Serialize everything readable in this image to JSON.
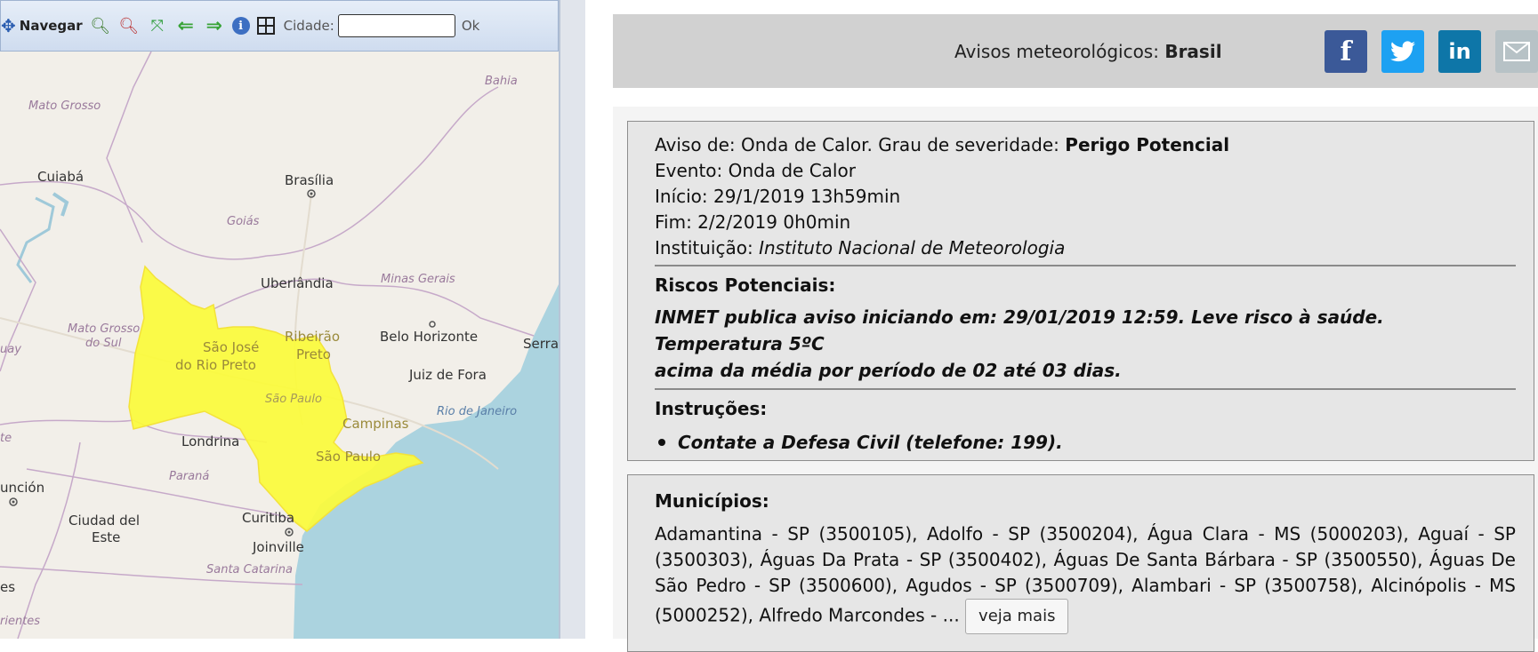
{
  "toolbar": {
    "navigate_label": "Navegar",
    "city_label": "Cidade:",
    "city_value": "",
    "ok_label": "Ok"
  },
  "map": {
    "water_color": "#abd3df",
    "land_color": "#f2efe9",
    "alert_color": "#fbfb3a",
    "labels": {
      "bahia": "Bahia",
      "mato_grosso": "Mato Grosso",
      "cuiaba": "Cuiabá",
      "brasilia": "Brasília",
      "goias": "Goiás",
      "uberlandia": "Uberlândia",
      "minas_gerais": "Minas Gerais",
      "mato_grosso_do_sul_1": "Mato Grosso",
      "mato_grosso_do_sul_2": "do Sul",
      "sao_jose_1": "São José",
      "sao_jose_2": "do Rio Preto",
      "ribeirao_1": "Ribeirão",
      "ribeirao_2": "Preto",
      "belo_horizonte": "Belo Horizonte",
      "serra": "Serra",
      "juiz_de_fora": "Juiz de Fora",
      "sao_paulo_state": "São Paulo",
      "rio_de_janeiro": "Rio de Janeiro",
      "campinas": "Campinas",
      "londrina": "Londrina",
      "sao_paulo_city": "São Paulo",
      "parana": "Paraná",
      "asuncion": "unción",
      "ciudad_del_este_1": "Ciudad del",
      "ciudad_del_este_2": "Este",
      "curitiba": "Curitiba",
      "joinville": "Joinville",
      "santa_catarina": "Santa Catarina",
      "left_es": "es",
      "left_rientes": "rientes",
      "left_te": "te",
      "left_uay": "uay"
    }
  },
  "header": {
    "title_prefix": "Avisos meteorológicos:",
    "title_region": "Brasil"
  },
  "share": {
    "facebook_glyph": "f",
    "linkedin_glyph": "in"
  },
  "alert": {
    "aviso_prefix": "Aviso de: Onda de Calor. Grau de severidade:",
    "severity": "Perigo Potencial",
    "evento": "Evento: Onda de Calor",
    "inicio": "Início: 29/1/2019 13h59min",
    "fim": "Fim: 2/2/2019 0h0min",
    "instituicao_label": "Instituição:",
    "instituicao": "Instituto Nacional de Meteorologia",
    "riscos_title": "Riscos Potenciais:",
    "riscos_line1": "INMET publica aviso iniciando em: 29/01/2019 12:59. Leve risco à saúde. Temperatura 5ºC",
    "riscos_line2": "acima da média por período de 02 até 03 dias.",
    "instrucoes_title": "Instruções:",
    "instrucao_1": "Contate a Defesa Civil (telefone: 199)."
  },
  "municipios": {
    "title": "Municípios:",
    "text": "Adamantina - SP (3500105), Adolfo - SP (3500204), Água Clara - MS (5000203), Aguaí - SP (3500303), Águas Da Prata - SP (3500402), Águas De Santa Bárbara - SP (3500550), Águas De São Pedro - SP (3500600), Agudos - SP (3500709), Alambari - SP (3500758), Alcinópolis - MS (5000252), Alfredo Marcondes - ...",
    "see_more_label": "veja mais"
  }
}
